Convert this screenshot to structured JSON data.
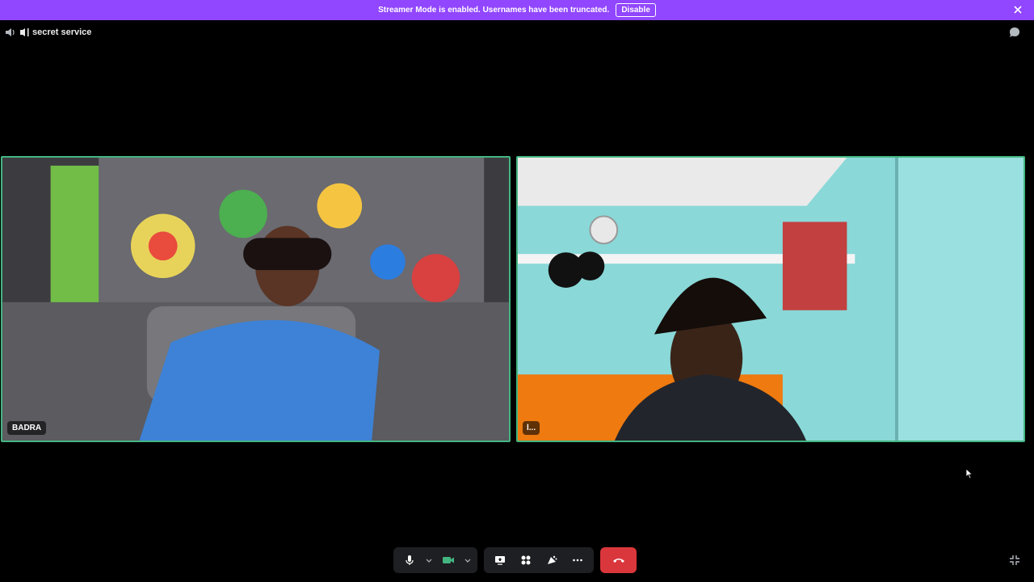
{
  "banner": {
    "message": "Streamer Mode is enabled. Usernames have been truncated.",
    "disable_label": "Disable"
  },
  "channel": {
    "name": "secret service",
    "icon": "channel-voice-icon"
  },
  "participants": [
    {
      "name": "BADRA"
    },
    {
      "name": "l..."
    }
  ],
  "controls": {
    "mic_icon": "microphone-icon",
    "camera_icon": "video-camera-icon",
    "share_icon": "screen-share-icon",
    "activities_icon": "activities-icon",
    "soundboard_icon": "soundboard-icon",
    "more_icon": "more-icon",
    "leave_icon": "leave-call-icon"
  },
  "colors": {
    "banner": "#9146ff",
    "speaking_border": "#43b581",
    "leave": "#da373c",
    "camera_on": "#43b581"
  }
}
